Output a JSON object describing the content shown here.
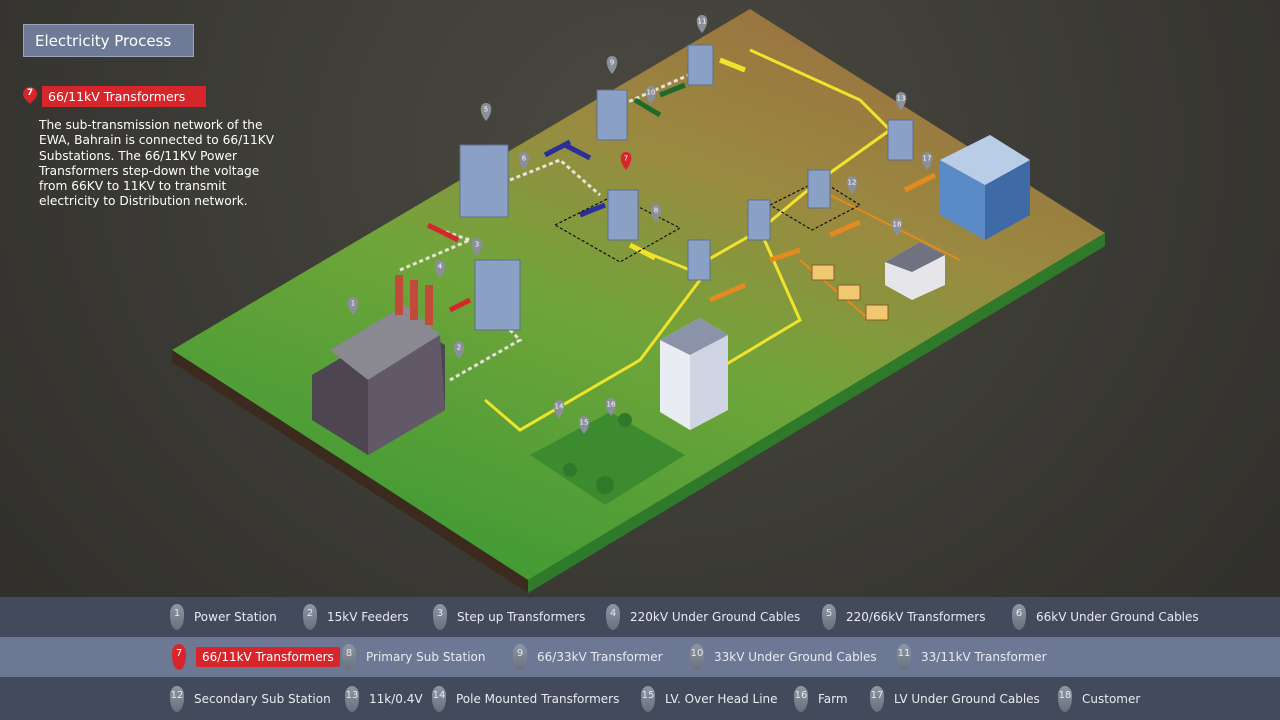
{
  "title": "Electricity Process",
  "selected": {
    "number": "7",
    "title": "66/11kV Transformers",
    "description": "The sub-transmission network of the EWA, Bahrain is connected to 66/11KV Substations. The 66/11KV Power Transformers step-down the voltage from 66KV to 11KV to transmit electricity to Distribution network."
  },
  "colors": {
    "accent_red": "#d7262b",
    "legend_dark": "#424a5c",
    "legend_highlight": "#6d7894",
    "title_box": "#6e7a96"
  },
  "legend": {
    "rows": [
      [
        {
          "number": "1",
          "label": "Power Station"
        },
        {
          "number": "2",
          "label": "15kV Feeders"
        },
        {
          "number": "3",
          "label": "Step up Transformers"
        },
        {
          "number": "4",
          "label": "220kV Under Ground Cables"
        },
        {
          "number": "5",
          "label": "220/66kV Transformers"
        },
        {
          "number": "6",
          "label": "66kV Under Ground Cables"
        }
      ],
      [
        {
          "number": "7",
          "label": "66/11kV Transformers",
          "active": true
        },
        {
          "number": "8",
          "label": "Primary Sub Station"
        },
        {
          "number": "9",
          "label": "66/33kV Transformer"
        },
        {
          "number": "10",
          "label": "33kV Under Ground Cables"
        },
        {
          "number": "11",
          "label": "33/11kV Transformer"
        }
      ],
      [
        {
          "number": "12",
          "label": "Secondary Sub Station"
        },
        {
          "number": "13",
          "label": "11k/0.4V"
        },
        {
          "number": "14",
          "label": "Pole Mounted Transformers"
        },
        {
          "number": "15",
          "label": "LV. Over Head Line"
        },
        {
          "number": "16",
          "label": "Farm"
        },
        {
          "number": "17",
          "label": "LV Under Ground Cables"
        },
        {
          "number": "18",
          "label": "Customer"
        }
      ]
    ]
  },
  "scene_markers": [
    "1",
    "2",
    "3",
    "4",
    "5",
    "6",
    "7",
    "8",
    "9",
    "10",
    "11",
    "12",
    "13",
    "14",
    "15",
    "16",
    "17",
    "18"
  ]
}
